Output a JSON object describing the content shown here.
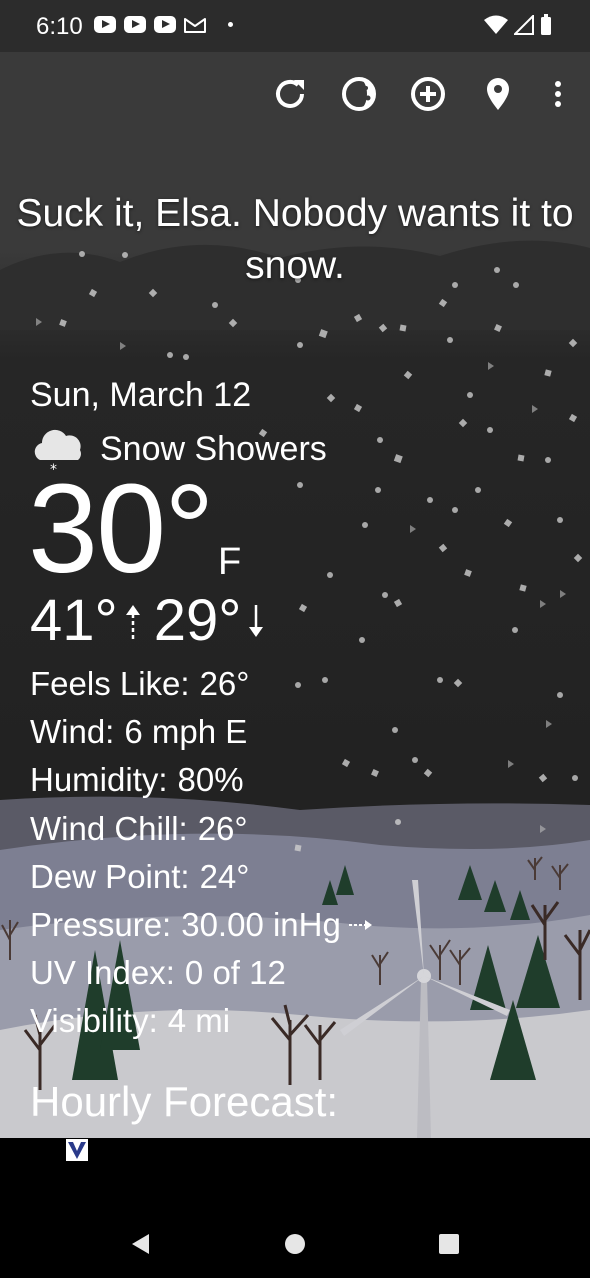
{
  "status_bar": {
    "time": "6:10",
    "notification_icons": [
      "youtube-icon",
      "youtube-icon",
      "youtube-icon",
      "gmail-icon",
      "dot-icon"
    ],
    "system_icons": [
      "wifi-icon",
      "signal-icon",
      "battery-icon"
    ]
  },
  "toolbar": {
    "icons": [
      "refresh-icon",
      "theme-icon",
      "add-location-icon",
      "location-pin-icon",
      "overflow-menu-icon"
    ]
  },
  "tagline": "Suck it, Elsa. Nobody wants it to snow.",
  "weather": {
    "date": "Sun, March 12",
    "condition_icon": "snow-cloud-icon",
    "condition": "Snow Showers",
    "temperature": "30°",
    "unit": "F",
    "high": "41°",
    "low": "29°"
  },
  "details": [
    {
      "label": "Feels Like:",
      "value": "26°"
    },
    {
      "label": "Wind:",
      "value": "6 mph E"
    },
    {
      "label": "Humidity:",
      "value": "80%"
    },
    {
      "label": "Wind Chill:",
      "value": "26°"
    },
    {
      "label": "Dew Point:",
      "value": "24°"
    },
    {
      "label": "Pressure:",
      "value": "30.00 inHg"
    },
    {
      "label": "UV Index:",
      "value": "0 of 12"
    },
    {
      "label": "Visibility:",
      "value": "4 mi"
    }
  ],
  "hourly_title": "Hourly Forecast:",
  "colors": {
    "sky_top": "#3a3a3a",
    "sky_bottom": "#1c1c1c",
    "snow_ground": "#c9c9cd",
    "text": "#ffffff"
  }
}
